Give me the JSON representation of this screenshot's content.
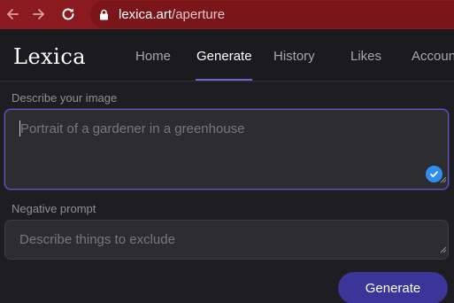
{
  "browser": {
    "url_host": "lexica.art",
    "url_path": "/aperture",
    "icons": [
      "back-arrow-icon",
      "forward-arrow-icon",
      "reload-icon",
      "lock-icon"
    ],
    "bar_color": "#8a1a1f"
  },
  "header": {
    "logo": "Lexica",
    "tabs": [
      {
        "label": "Home",
        "active": false
      },
      {
        "label": "Generate",
        "active": true
      },
      {
        "label": "History",
        "active": false
      },
      {
        "label": "Likes",
        "active": false
      },
      {
        "label": "Accoun",
        "active": false
      }
    ],
    "accent_color": "#6a66d6"
  },
  "form": {
    "prompt_label": "Describe your image",
    "prompt_placeholder": "Portrait of a gardener in a greenhouse",
    "prompt_value": "",
    "negative_label": "Negative prompt",
    "negative_placeholder": "Describe things to exclude",
    "negative_value": "",
    "generate_label": "Generate",
    "button_color": "#3b3499"
  }
}
